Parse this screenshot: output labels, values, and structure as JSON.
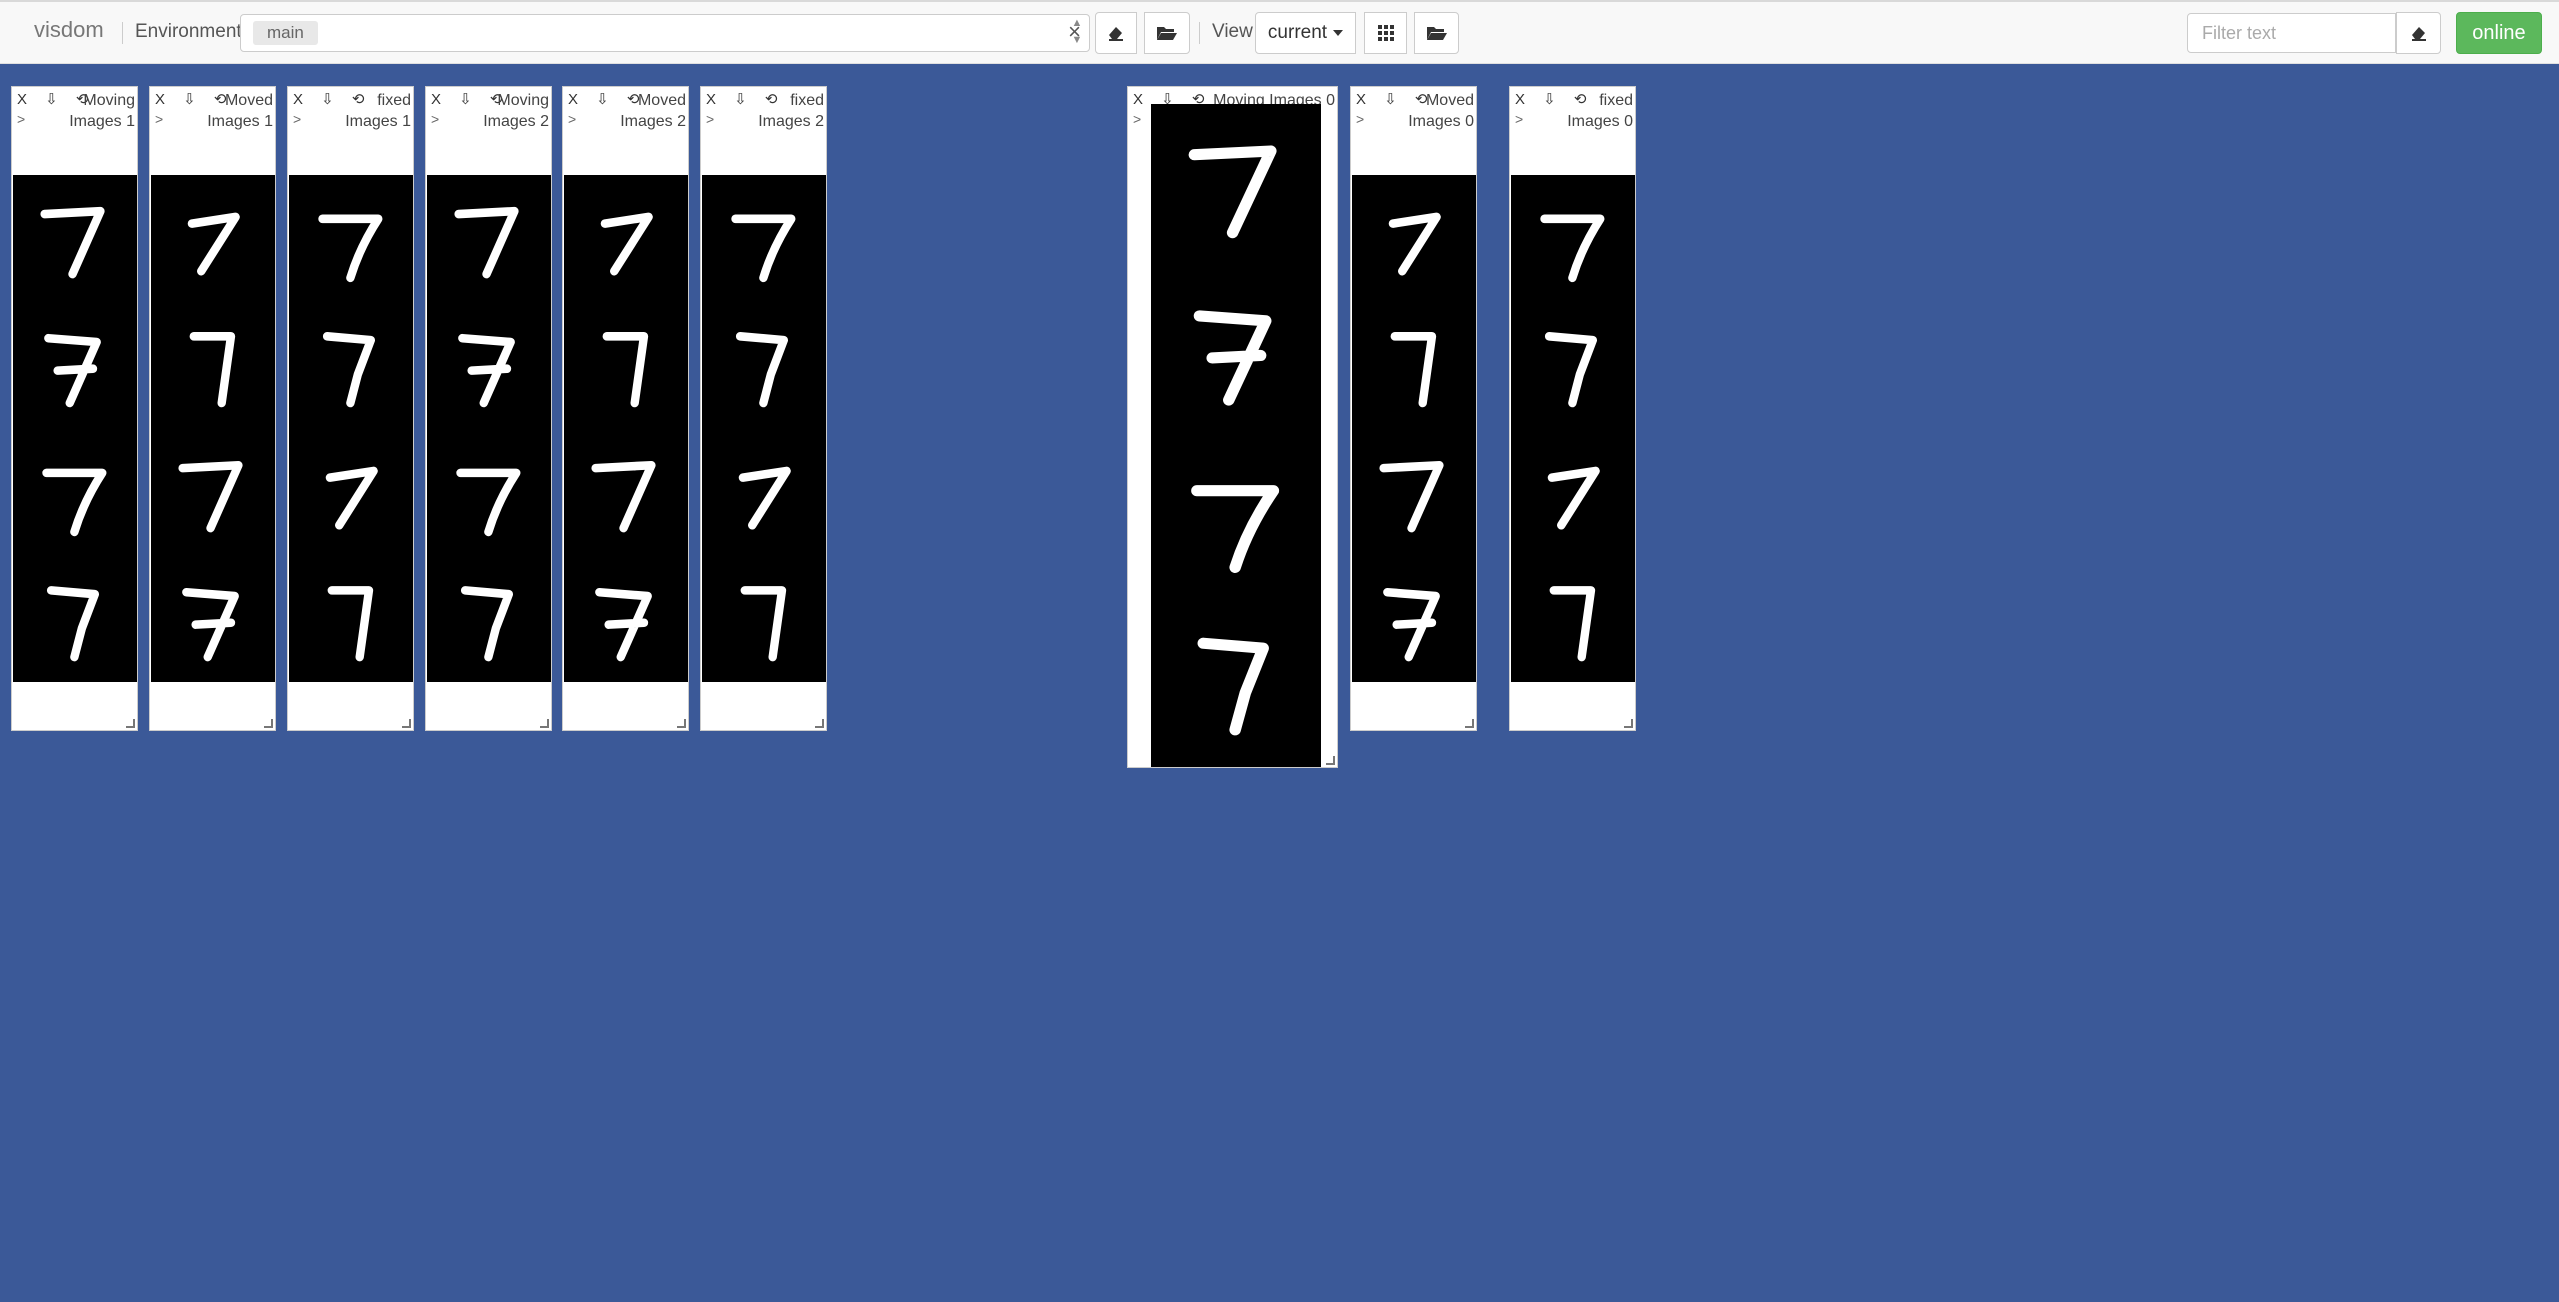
{
  "navbar": {
    "brand": "visdom",
    "environment_label": "Environment",
    "environment_value": "main",
    "clear_symbol": "×",
    "view_label": "View",
    "view_value": "current",
    "filter_placeholder": "Filter text",
    "status": "online"
  },
  "panes": [
    {
      "title": "Moving Images 1",
      "controls": "X ⇩ ⟲",
      "expand": ">"
    },
    {
      "title": "Moved Images 1",
      "controls": "X ⇩ ⟲",
      "expand": ">"
    },
    {
      "title": "fixed Images 1",
      "controls": "X ⇩ ⟲",
      "expand": ">"
    },
    {
      "title": "Moving Images 2",
      "controls": "X ⇩ ⟲",
      "expand": ">"
    },
    {
      "title": "Moved Images 2",
      "controls": "X ⇩ ⟲",
      "expand": ">"
    },
    {
      "title": "fixed Images 2",
      "controls": "X ⇩ ⟲",
      "expand": ">"
    },
    {
      "title": "Moving Images 0",
      "controls": "X ⇩ ⟲",
      "expand": ">"
    },
    {
      "title": "Moved Images 0",
      "controls": "X ⇩ ⟲",
      "expand": ">"
    },
    {
      "title": "fixed Images 0",
      "controls": "X ⇩ ⟲",
      "expand": ">"
    }
  ]
}
